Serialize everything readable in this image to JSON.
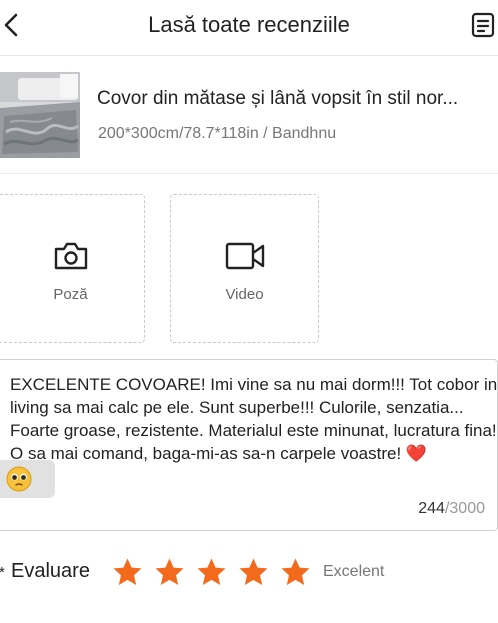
{
  "header": {
    "title": "Lasă toate recenziile",
    "back_icon": "chevron-left-icon",
    "menu_icon": "list-menu-icon"
  },
  "product": {
    "name": "Covor din mătase și lână vopsit în stil nor...",
    "variant": "200*300cm/78.7*118in / Bandhnu"
  },
  "upload": {
    "photo_label": "Poză",
    "photo_icon": "camera-icon",
    "video_label": "Video",
    "video_icon": "video-camera-icon"
  },
  "review": {
    "text": "EXCELENTE COVOARE! Imi vine sa nu mai dorm!!! Tot cobor in living sa mai calc pe ele. Sunt superbe!!! Culorile, senzatia... Foarte groase, rezistente. Materialul este minunat, lucratura fina! O sa mai comand, baga-mi-as sa-n carpele voastre! ❤️",
    "count": "244",
    "max": "/3000"
  },
  "rating": {
    "required_mark": "*",
    "label": "Evaluare",
    "value": 5,
    "max": 5,
    "word": "Excelent",
    "star_color": "#f46a1d"
  },
  "colors": {
    "text": "#222222",
    "muted": "#777777",
    "accent": "#f46a1d"
  }
}
